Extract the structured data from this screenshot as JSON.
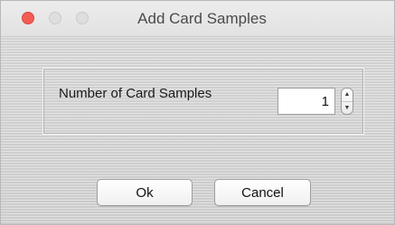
{
  "window": {
    "title": "Add Card Samples"
  },
  "form": {
    "label": "Number of Card Samples",
    "value": "1"
  },
  "buttons": {
    "ok": "Ok",
    "cancel": "Cancel"
  },
  "icons": {
    "stepper_up": "▲",
    "stepper_down": "▼"
  },
  "colors": {
    "close": "#f25c54",
    "inactive_traffic": "#dedede"
  }
}
